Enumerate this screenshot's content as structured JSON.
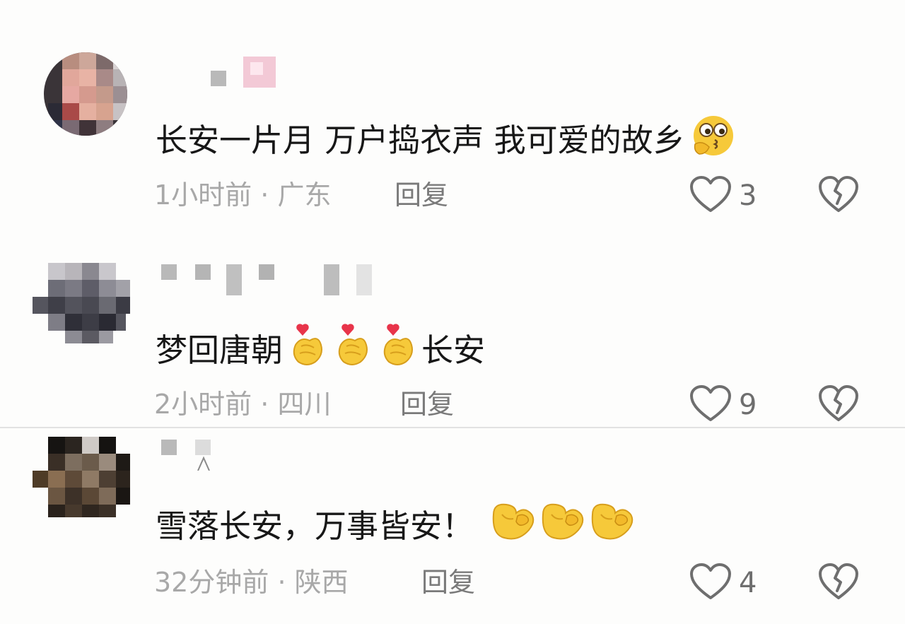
{
  "comments": [
    {
      "text": "长安一片月 万户捣衣声 我可爱的故乡",
      "emoji": "thinking-face-icon",
      "time": "1小时前",
      "location": "广东",
      "reply_label": "回复",
      "likes": "3"
    },
    {
      "text_before": "梦回唐朝",
      "emoji": "finger-heart-icon",
      "text_after": "长安",
      "time": "2小时前",
      "location": "四川",
      "reply_label": "回复",
      "likes": "9"
    },
    {
      "text": "雪落长安，万事皆安！",
      "emoji": "flexed-biceps-icon",
      "time": "32分钟前",
      "location": "陕西",
      "reply_label": "回复",
      "likes": "4"
    }
  ],
  "separator": " · ",
  "colors": {
    "text": "#171717",
    "meta": "#a8a8a8",
    "icon": "#6e6e6e",
    "emoji_yellow": "#f6c93a",
    "heart_red": "#e8344a"
  }
}
